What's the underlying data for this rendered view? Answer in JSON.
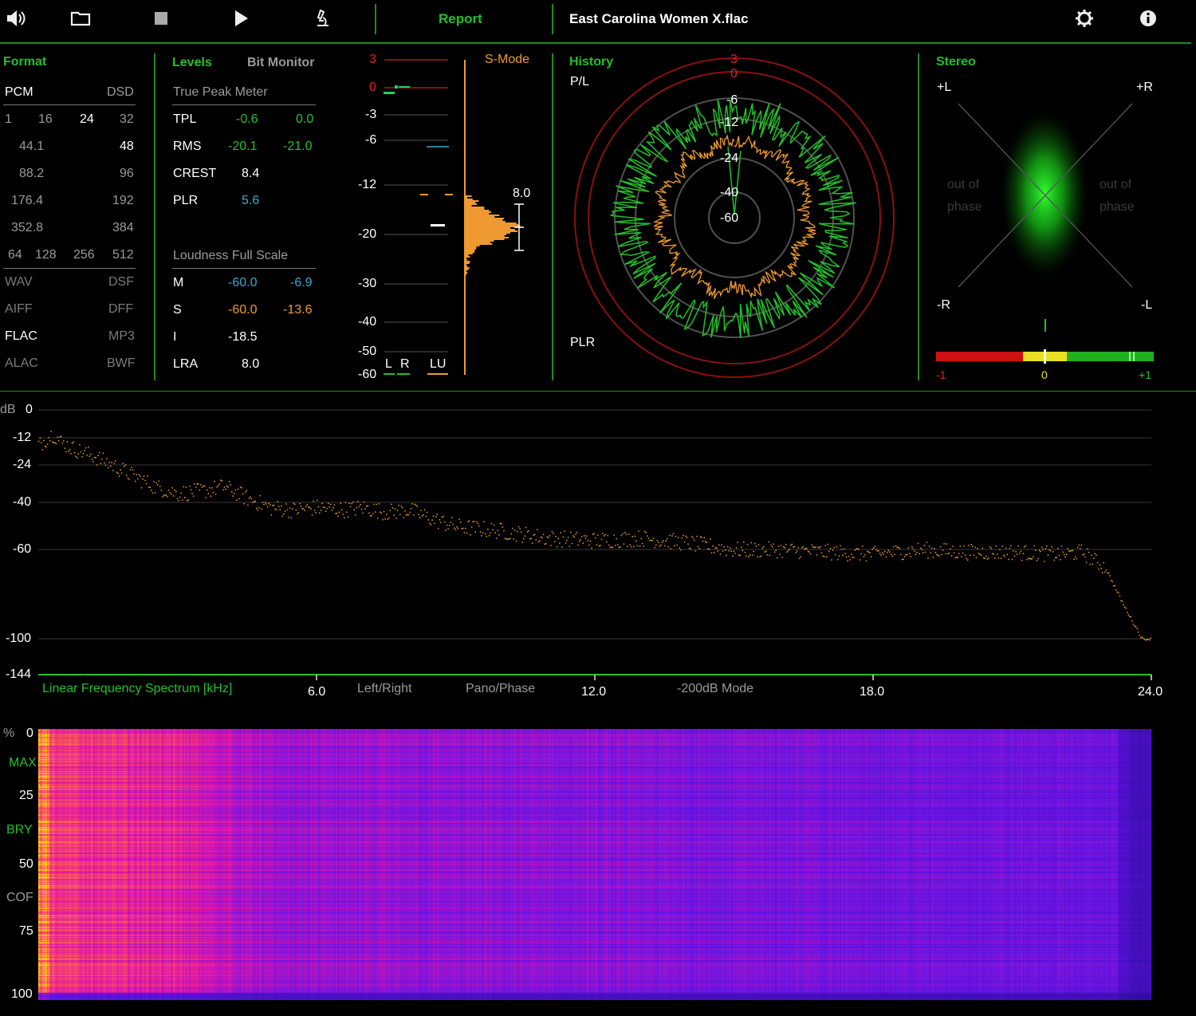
{
  "toolbar": {
    "report_label": "Report",
    "file_name": "East Carolina Women X.flac",
    "icons": [
      "speaker-icon",
      "folder-icon",
      "stop-icon",
      "play-icon",
      "microscope-icon",
      "gear-icon",
      "info-icon"
    ]
  },
  "format": {
    "title": "Format",
    "pcm": "PCM",
    "dsd": "DSD",
    "bits": [
      "1",
      "16",
      "24",
      "32"
    ],
    "rates": [
      [
        "44.1",
        "48"
      ],
      [
        "88.2",
        "96"
      ],
      [
        "176.4",
        "192"
      ],
      [
        "352.8",
        "384"
      ]
    ],
    "dsd_rates": [
      "64",
      "128",
      "256",
      "512"
    ],
    "containers": [
      [
        "WAV",
        "DSF"
      ],
      [
        "AIFF",
        "DFF"
      ],
      [
        "FLAC",
        "MP3"
      ],
      [
        "ALAC",
        "BWF"
      ]
    ]
  },
  "levels": {
    "title": "Levels",
    "bit_monitor": "Bit Monitor",
    "true_peak_title": "True Peak Meter",
    "rows": [
      {
        "label": "TPL",
        "a": "-0.6",
        "b": "0.0"
      },
      {
        "label": "RMS",
        "a": "-20.1",
        "b": "-21.0"
      },
      {
        "label": "CREST",
        "a": "8.4",
        "b": ""
      },
      {
        "label": "PLR",
        "a": "5.6",
        "b": ""
      }
    ],
    "lufs_title": "Loudness Full Scale",
    "lufs_rows": [
      {
        "label": "M",
        "a": "-60.0",
        "b": "-6.9"
      },
      {
        "label": "S",
        "a": "-60.0",
        "b": "-13.6"
      },
      {
        "label": "I",
        "a": "-18.5",
        "b": ""
      },
      {
        "label": "LRA",
        "a": "8.0",
        "b": ""
      }
    ]
  },
  "meter": {
    "ticks": [
      "3",
      "0",
      "-3",
      "-6",
      "-12",
      "-20",
      "-30",
      "-40",
      "-50",
      "-60"
    ],
    "smode": "S-Mode",
    "histo_value": "8.0",
    "channels": [
      "L",
      "R",
      "LU"
    ]
  },
  "history": {
    "title": "History",
    "pl": "P/L",
    "plr": "PLR",
    "rings": [
      "3",
      "0",
      "-6",
      "-12",
      "-24",
      "-40",
      "-60"
    ]
  },
  "stereo": {
    "title": "Stereo",
    "corners": [
      "+L",
      "+R",
      "-R",
      "-L"
    ],
    "phase_text": [
      "out of",
      "phase"
    ],
    "scale": [
      "-1",
      "0",
      "+1"
    ],
    "correlation": 0.0
  },
  "spectrum": {
    "y_ticks": [
      "0",
      "-12",
      "-24",
      "-40",
      "-60",
      "-100",
      "-144"
    ],
    "y_unit": "dB",
    "x_ticks": [
      "6.0",
      "12.0",
      "18.0",
      "24.0"
    ],
    "label": "Linear Frequency Spectrum [kHz]",
    "buttons": [
      "Left/Right",
      "Pano/Phase",
      "-200dB Mode"
    ],
    "profile": [
      [
        0,
        -15
      ],
      [
        0.3,
        -10
      ],
      [
        0.5,
        -14
      ],
      [
        0.8,
        -17
      ],
      [
        1.2,
        -20
      ],
      [
        1.6,
        -24
      ],
      [
        2.0,
        -28
      ],
      [
        2.5,
        -33
      ],
      [
        3.0,
        -36
      ],
      [
        3.5,
        -35
      ],
      [
        4.0,
        -33
      ],
      [
        4.5,
        -38
      ],
      [
        5.0,
        -42
      ],
      [
        5.5,
        -43
      ],
      [
        6.0,
        -42
      ],
      [
        6.5,
        -43
      ],
      [
        7.0,
        -42
      ],
      [
        7.5,
        -44
      ],
      [
        8.0,
        -43
      ],
      [
        8.5,
        -47
      ],
      [
        9.0,
        -50
      ],
      [
        10.0,
        -52
      ],
      [
        11.0,
        -55
      ],
      [
        12.0,
        -56
      ],
      [
        13.0,
        -55
      ],
      [
        14.0,
        -57
      ],
      [
        15.0,
        -60
      ],
      [
        16.0,
        -60
      ],
      [
        17.0,
        -61
      ],
      [
        18.0,
        -62
      ],
      [
        19.0,
        -60
      ],
      [
        20.0,
        -61
      ],
      [
        21.0,
        -61
      ],
      [
        22.0,
        -62
      ],
      [
        22.5,
        -61
      ],
      [
        23.0,
        -68
      ],
      [
        23.4,
        -85
      ],
      [
        23.8,
        -100
      ],
      [
        24.0,
        -100
      ]
    ]
  },
  "spectrogram": {
    "unit": "%",
    "ticks": [
      "0",
      "25",
      "50",
      "75",
      "100"
    ],
    "markers": [
      "MAX",
      "BRY",
      "COF"
    ]
  }
}
